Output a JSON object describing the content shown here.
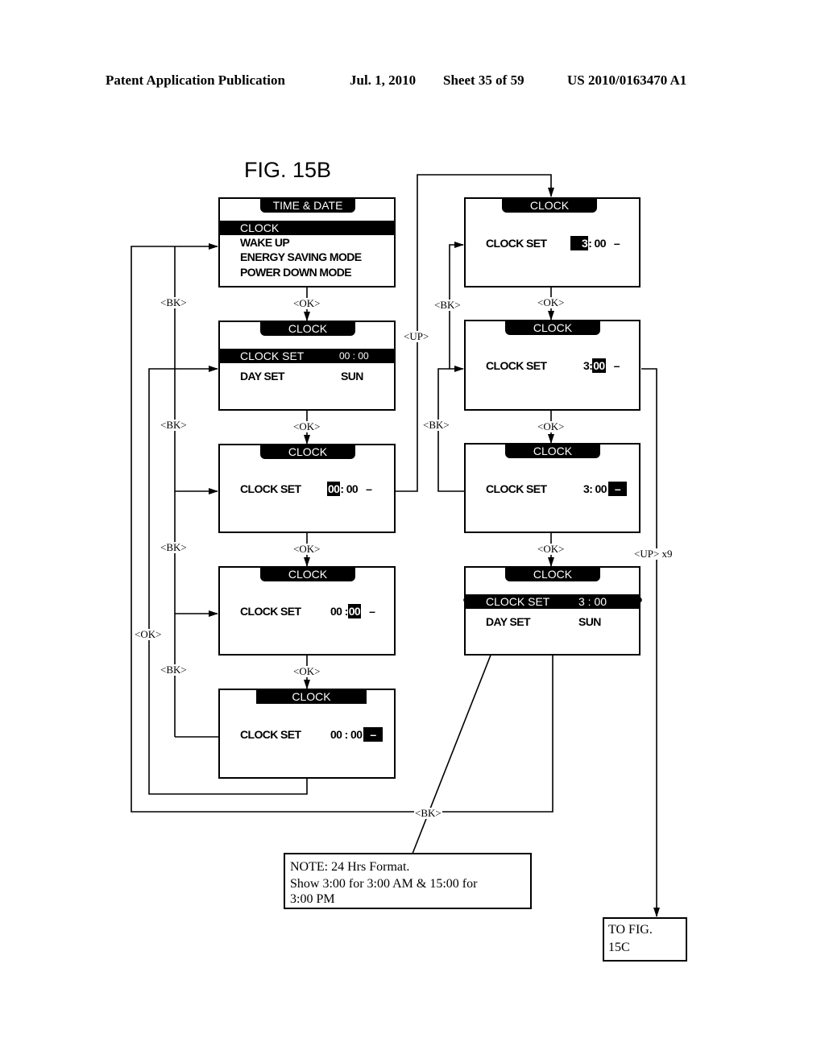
{
  "header": {
    "publication": "Patent Application Publication",
    "date": "Jul. 1, 2010",
    "sheet": "Sheet 35 of 59",
    "number": "US 2010/0163470 A1"
  },
  "figure": {
    "title": "FIG. 15B"
  },
  "screens": {
    "menu": {
      "tab": "TIME & DATE",
      "items": [
        "CLOCK",
        "WAKE UP",
        "ENERGY SAVING MODE",
        "POWER DOWN MODE"
      ],
      "selected_index": 0
    },
    "clock_menu": {
      "tab": "CLOCK",
      "rows": [
        {
          "label": "CLOCK SET",
          "value": "00 : 00"
        },
        {
          "label": "DAY SET",
          "value": "SUN"
        }
      ]
    },
    "left_hour": {
      "tab": "CLOCK",
      "label": "CLOCK SET",
      "hour": "00",
      "sep": ":",
      "minute": "00",
      "ampm": "–",
      "highlight": "hour"
    },
    "left_minute": {
      "tab": "CLOCK",
      "label": "CLOCK SET",
      "hour": "00",
      "sep": ":",
      "minute": "00",
      "ampm": "–",
      "highlight": "minute"
    },
    "left_ampm": {
      "tab": "CLOCK",
      "label": "CLOCK SET",
      "hour": "00",
      "sep": ":",
      "minute": "00",
      "ampm": "–",
      "highlight": "ampm"
    },
    "right_hour": {
      "tab": "CLOCK",
      "label": "CLOCK SET",
      "hour": "3",
      "sep": ":",
      "minute": "00",
      "ampm": "–",
      "highlight": "hour"
    },
    "right_minute": {
      "tab": "CLOCK",
      "label": "CLOCK SET",
      "hour": "3",
      "sep": ":",
      "minute": "00",
      "ampm": "–",
      "highlight": "minute"
    },
    "right_ampm": {
      "tab": "CLOCK",
      "label": "CLOCK SET",
      "hour": "3",
      "sep": ":",
      "minute": "00",
      "ampm": "–",
      "highlight": "ampm"
    },
    "result": {
      "tab": "CLOCK",
      "rows": [
        {
          "label": "CLOCK SET",
          "value": "3 : 00"
        },
        {
          "label": "DAY SET",
          "value": "SUN"
        }
      ]
    }
  },
  "labels": {
    "ok": "<OK>",
    "bk": "<BK>",
    "up": "<UP>",
    "up_x9": "<UP> x9"
  },
  "note": {
    "line1": "NOTE: 24   Hrs Format.",
    "line2": "Show 3:00 for  3:00 AM & 15:00  for",
    "line3": "3:00 PM"
  },
  "connector": {
    "line1": "TO FIG.",
    "line2": "15C"
  }
}
